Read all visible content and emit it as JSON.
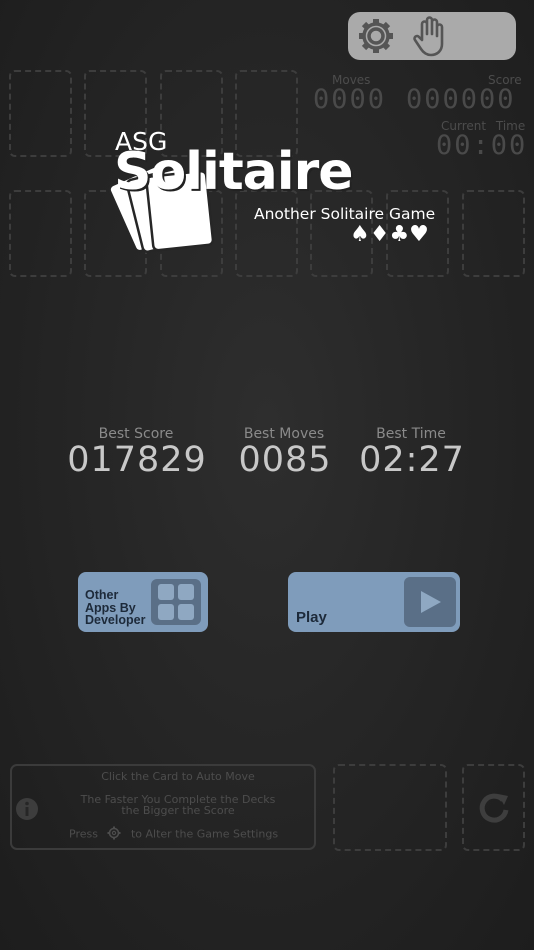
{
  "stats_header": {
    "moves_label": "Moves",
    "score_label": "Score",
    "moves_value": "0000",
    "score_value": "000000",
    "time_label": "Current Time",
    "time_value": "00:00"
  },
  "logo": {
    "asg": "ASG",
    "title": "Solitaire",
    "subtitle": "Another Solitaire Game",
    "suits": "♠♦♣♥"
  },
  "best": {
    "score_label": "Best Score",
    "score_value": "017829",
    "moves_label": "Best Moves",
    "moves_value": "0085",
    "time_label": "Best Time",
    "time_value": "02:27"
  },
  "buttons": {
    "other_apps": "Other Apps By Developer",
    "play": "Play"
  },
  "info": {
    "line1": "Click the Card to Auto Move",
    "line2": "The Faster You Complete the Decks",
    "line3": "the Bigger the Score",
    "line4_pre": "Press",
    "line4_post": "to Alter the Game Settings"
  },
  "icons": {
    "settings": "gear-icon",
    "hand": "hand-icon",
    "info": "info-icon",
    "apps_grid": "grid-icon",
    "play": "play-icon",
    "refresh": "refresh-icon"
  },
  "colors": {
    "background": "#262626",
    "button": "#7f9cbb",
    "button_icon_bg": "#5a6f87",
    "toolbar": "#aaaaaa"
  }
}
